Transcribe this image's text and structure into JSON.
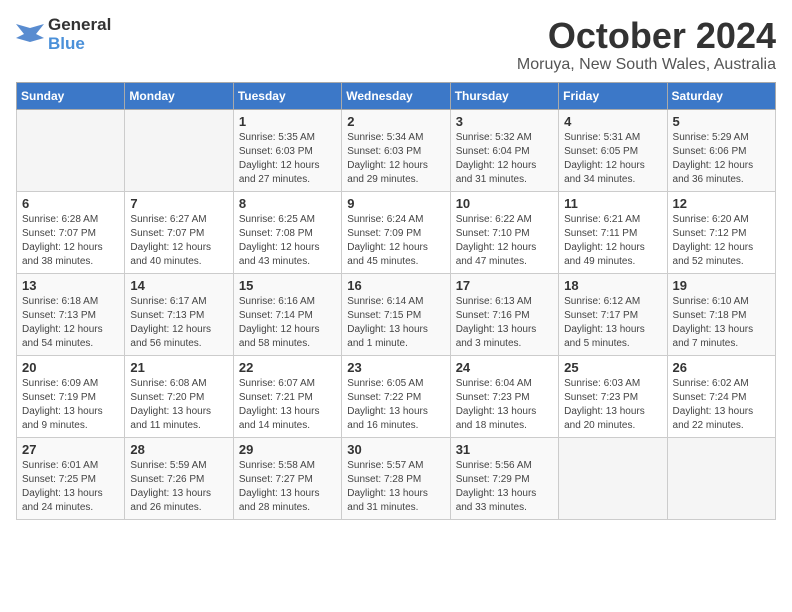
{
  "logo": {
    "general": "General",
    "blue": "Blue"
  },
  "title": "October 2024",
  "location": "Moruya, New South Wales, Australia",
  "headers": [
    "Sunday",
    "Monday",
    "Tuesday",
    "Wednesday",
    "Thursday",
    "Friday",
    "Saturday"
  ],
  "weeks": [
    [
      {
        "day": "",
        "sunrise": "",
        "sunset": "",
        "daylight": ""
      },
      {
        "day": "",
        "sunrise": "",
        "sunset": "",
        "daylight": ""
      },
      {
        "day": "1",
        "sunrise": "Sunrise: 5:35 AM",
        "sunset": "Sunset: 6:03 PM",
        "daylight": "Daylight: 12 hours and 27 minutes."
      },
      {
        "day": "2",
        "sunrise": "Sunrise: 5:34 AM",
        "sunset": "Sunset: 6:03 PM",
        "daylight": "Daylight: 12 hours and 29 minutes."
      },
      {
        "day": "3",
        "sunrise": "Sunrise: 5:32 AM",
        "sunset": "Sunset: 6:04 PM",
        "daylight": "Daylight: 12 hours and 31 minutes."
      },
      {
        "day": "4",
        "sunrise": "Sunrise: 5:31 AM",
        "sunset": "Sunset: 6:05 PM",
        "daylight": "Daylight: 12 hours and 34 minutes."
      },
      {
        "day": "5",
        "sunrise": "Sunrise: 5:29 AM",
        "sunset": "Sunset: 6:06 PM",
        "daylight": "Daylight: 12 hours and 36 minutes."
      }
    ],
    [
      {
        "day": "6",
        "sunrise": "Sunrise: 6:28 AM",
        "sunset": "Sunset: 7:07 PM",
        "daylight": "Daylight: 12 hours and 38 minutes."
      },
      {
        "day": "7",
        "sunrise": "Sunrise: 6:27 AM",
        "sunset": "Sunset: 7:07 PM",
        "daylight": "Daylight: 12 hours and 40 minutes."
      },
      {
        "day": "8",
        "sunrise": "Sunrise: 6:25 AM",
        "sunset": "Sunset: 7:08 PM",
        "daylight": "Daylight: 12 hours and 43 minutes."
      },
      {
        "day": "9",
        "sunrise": "Sunrise: 6:24 AM",
        "sunset": "Sunset: 7:09 PM",
        "daylight": "Daylight: 12 hours and 45 minutes."
      },
      {
        "day": "10",
        "sunrise": "Sunrise: 6:22 AM",
        "sunset": "Sunset: 7:10 PM",
        "daylight": "Daylight: 12 hours and 47 minutes."
      },
      {
        "day": "11",
        "sunrise": "Sunrise: 6:21 AM",
        "sunset": "Sunset: 7:11 PM",
        "daylight": "Daylight: 12 hours and 49 minutes."
      },
      {
        "day": "12",
        "sunrise": "Sunrise: 6:20 AM",
        "sunset": "Sunset: 7:12 PM",
        "daylight": "Daylight: 12 hours and 52 minutes."
      }
    ],
    [
      {
        "day": "13",
        "sunrise": "Sunrise: 6:18 AM",
        "sunset": "Sunset: 7:13 PM",
        "daylight": "Daylight: 12 hours and 54 minutes."
      },
      {
        "day": "14",
        "sunrise": "Sunrise: 6:17 AM",
        "sunset": "Sunset: 7:13 PM",
        "daylight": "Daylight: 12 hours and 56 minutes."
      },
      {
        "day": "15",
        "sunrise": "Sunrise: 6:16 AM",
        "sunset": "Sunset: 7:14 PM",
        "daylight": "Daylight: 12 hours and 58 minutes."
      },
      {
        "day": "16",
        "sunrise": "Sunrise: 6:14 AM",
        "sunset": "Sunset: 7:15 PM",
        "daylight": "Daylight: 13 hours and 1 minute."
      },
      {
        "day": "17",
        "sunrise": "Sunrise: 6:13 AM",
        "sunset": "Sunset: 7:16 PM",
        "daylight": "Daylight: 13 hours and 3 minutes."
      },
      {
        "day": "18",
        "sunrise": "Sunrise: 6:12 AM",
        "sunset": "Sunset: 7:17 PM",
        "daylight": "Daylight: 13 hours and 5 minutes."
      },
      {
        "day": "19",
        "sunrise": "Sunrise: 6:10 AM",
        "sunset": "Sunset: 7:18 PM",
        "daylight": "Daylight: 13 hours and 7 minutes."
      }
    ],
    [
      {
        "day": "20",
        "sunrise": "Sunrise: 6:09 AM",
        "sunset": "Sunset: 7:19 PM",
        "daylight": "Daylight: 13 hours and 9 minutes."
      },
      {
        "day": "21",
        "sunrise": "Sunrise: 6:08 AM",
        "sunset": "Sunset: 7:20 PM",
        "daylight": "Daylight: 13 hours and 11 minutes."
      },
      {
        "day": "22",
        "sunrise": "Sunrise: 6:07 AM",
        "sunset": "Sunset: 7:21 PM",
        "daylight": "Daylight: 13 hours and 14 minutes."
      },
      {
        "day": "23",
        "sunrise": "Sunrise: 6:05 AM",
        "sunset": "Sunset: 7:22 PM",
        "daylight": "Daylight: 13 hours and 16 minutes."
      },
      {
        "day": "24",
        "sunrise": "Sunrise: 6:04 AM",
        "sunset": "Sunset: 7:23 PM",
        "daylight": "Daylight: 13 hours and 18 minutes."
      },
      {
        "day": "25",
        "sunrise": "Sunrise: 6:03 AM",
        "sunset": "Sunset: 7:23 PM",
        "daylight": "Daylight: 13 hours and 20 minutes."
      },
      {
        "day": "26",
        "sunrise": "Sunrise: 6:02 AM",
        "sunset": "Sunset: 7:24 PM",
        "daylight": "Daylight: 13 hours and 22 minutes."
      }
    ],
    [
      {
        "day": "27",
        "sunrise": "Sunrise: 6:01 AM",
        "sunset": "Sunset: 7:25 PM",
        "daylight": "Daylight: 13 hours and 24 minutes."
      },
      {
        "day": "28",
        "sunrise": "Sunrise: 5:59 AM",
        "sunset": "Sunset: 7:26 PM",
        "daylight": "Daylight: 13 hours and 26 minutes."
      },
      {
        "day": "29",
        "sunrise": "Sunrise: 5:58 AM",
        "sunset": "Sunset: 7:27 PM",
        "daylight": "Daylight: 13 hours and 28 minutes."
      },
      {
        "day": "30",
        "sunrise": "Sunrise: 5:57 AM",
        "sunset": "Sunset: 7:28 PM",
        "daylight": "Daylight: 13 hours and 31 minutes."
      },
      {
        "day": "31",
        "sunrise": "Sunrise: 5:56 AM",
        "sunset": "Sunset: 7:29 PM",
        "daylight": "Daylight: 13 hours and 33 minutes."
      },
      {
        "day": "",
        "sunrise": "",
        "sunset": "",
        "daylight": ""
      },
      {
        "day": "",
        "sunrise": "",
        "sunset": "",
        "daylight": ""
      }
    ]
  ]
}
